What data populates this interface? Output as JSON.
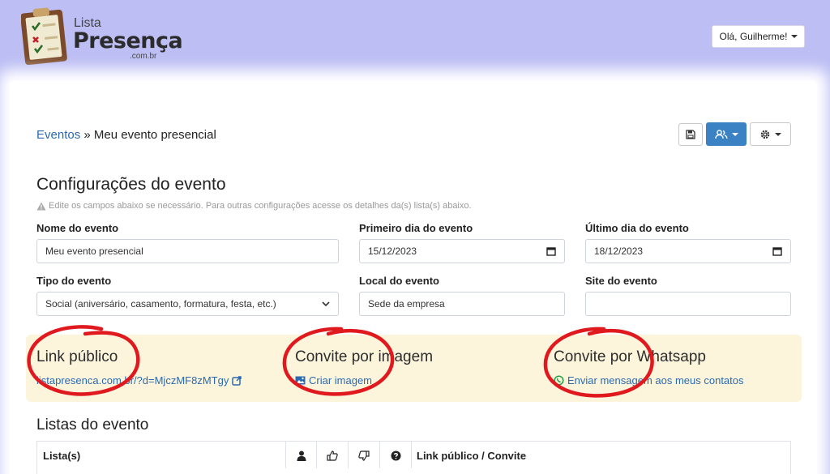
{
  "brand": {
    "small": "Lista",
    "big": "Presença",
    "domain": ".com.br"
  },
  "user_menu": {
    "label": "Olá, Guilherme!"
  },
  "breadcrumb": {
    "parent": "Eventos",
    "separator": " » ",
    "current": "Meu evento presencial"
  },
  "toolbar": {
    "save_icon": "floppy-disk-icon",
    "users_icon": "users-icon",
    "settings_icon": "gear-icon"
  },
  "config": {
    "title": "Configurações do evento",
    "hint": "Edite os campos abaixo se necessário. Para outras configurações acesse os detalhes da(s) lista(s) abaixo."
  },
  "form": {
    "name": {
      "label": "Nome do evento",
      "value": "Meu evento presencial"
    },
    "first_day": {
      "label": "Primeiro dia do evento",
      "value": "15/12/2023"
    },
    "last_day": {
      "label": "Último dia do evento",
      "value": "18/12/2023"
    },
    "type": {
      "label": "Tipo do evento",
      "value": "Social (aniversário, casamento, formatura, festa, etc.)"
    },
    "location": {
      "label": "Local do evento",
      "value": "Sede da empresa"
    },
    "site": {
      "label": "Site do evento",
      "value": ""
    }
  },
  "share": {
    "public_link": {
      "title": "Link público",
      "link": "listapresenca.com.br/?d=MjczMF8zMTgy"
    },
    "image_invite": {
      "title": "Convite por imagem",
      "link": "Criar imagem"
    },
    "whatsapp_invite": {
      "title": "Convite por Whatsapp",
      "link": "Enviar mensagem aos meus contatos"
    },
    "highlight_color": "#e0191f"
  },
  "lists": {
    "title": "Listas do evento",
    "columns": [
      "Lista(s)",
      "person-icon",
      "thumbs-up-icon",
      "thumbs-down-icon",
      "question-circle-icon",
      "Link público / Convite"
    ]
  }
}
